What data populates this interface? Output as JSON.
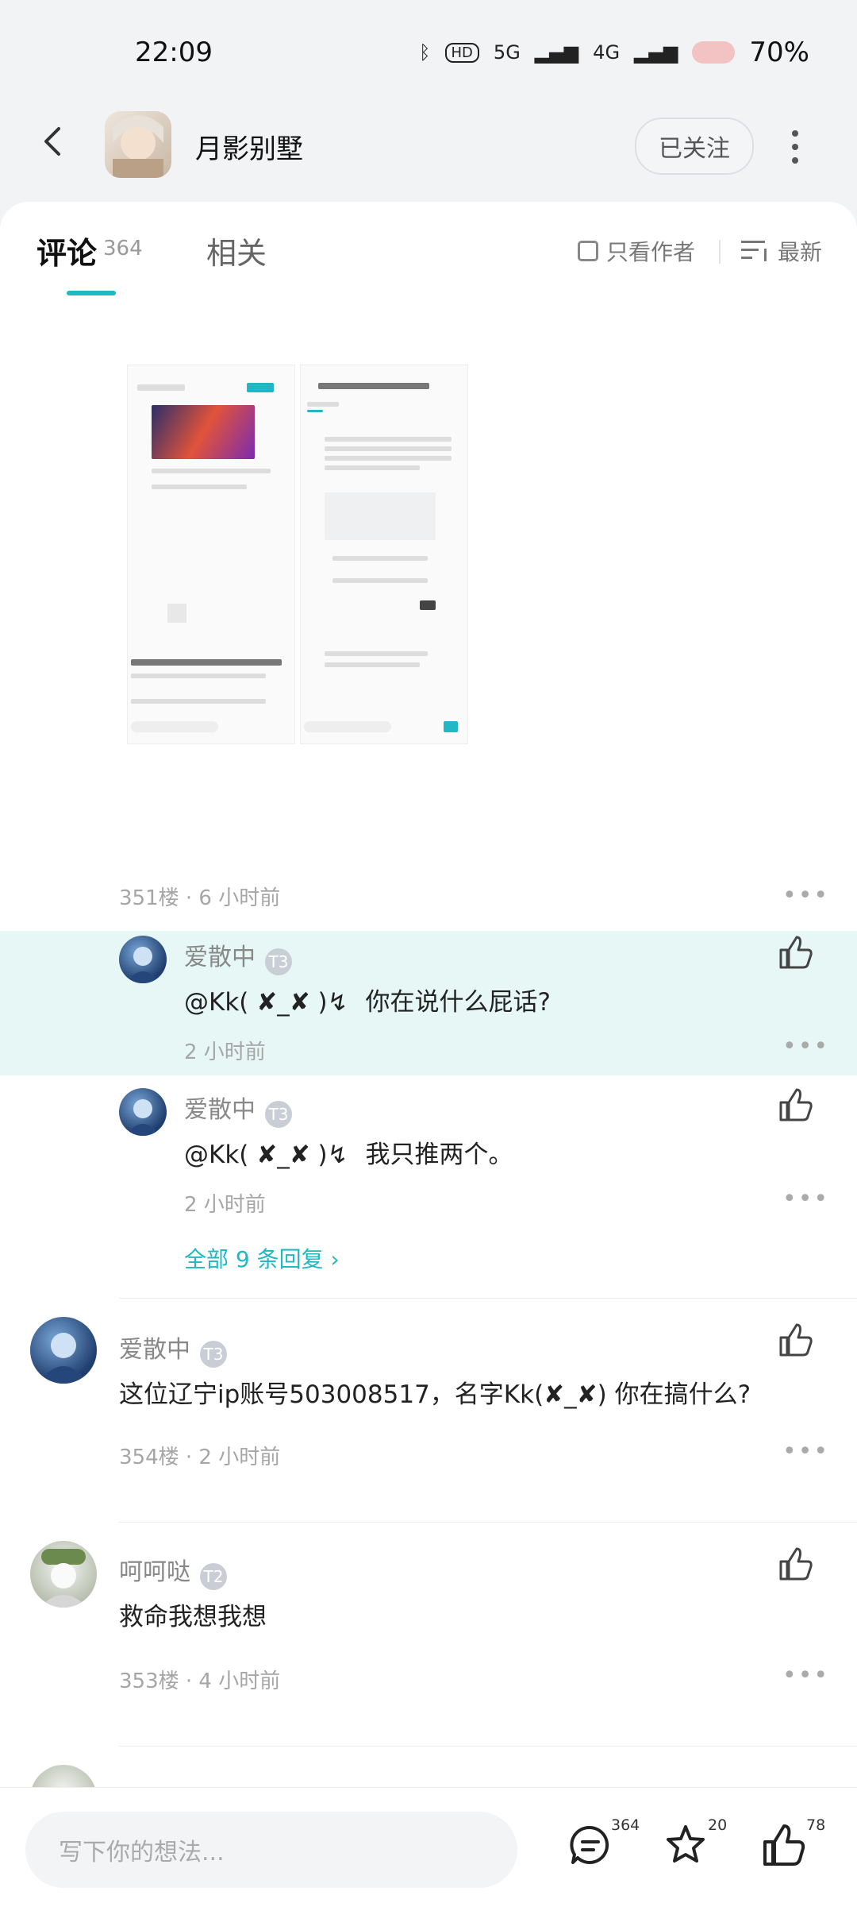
{
  "status_bar": {
    "time": "22:09",
    "network1": "5G",
    "network2": "4G",
    "battery": "70%"
  },
  "header": {
    "title": "月影别墅",
    "follow_label": "已关注"
  },
  "tabs": {
    "comments_label": "评论",
    "comments_count": "364",
    "related_label": "相关"
  },
  "filters": {
    "author_only": "只看作者",
    "sort_label": "最新"
  },
  "image_comment": {
    "meta": "351楼 · 6 小时前"
  },
  "replies": [
    {
      "name": "爱散中",
      "badge": "T3",
      "mention": "@Kk( ✘_✘ )↯",
      "text": "你在说什么屁话?",
      "meta": "2 小时前"
    },
    {
      "name": "爱散中",
      "badge": "T3",
      "mention": "@Kk( ✘_✘ )↯",
      "text": "我只推两个。",
      "meta": "2 小时前"
    }
  ],
  "replies_more": "全部 9 条回复 ›",
  "comments": [
    {
      "name": "爱散中",
      "badge": "T3",
      "text": "这位辽宁ip账号503008517，名字Kk(✘_✘) 你在搞什么?",
      "meta": "354楼 · 2 小时前"
    },
    {
      "name": "呵呵哒",
      "badge": "T2",
      "text": "救命我想我想",
      "meta": "353楼 · 4 小时前"
    }
  ],
  "bottom_bar": {
    "placeholder": "写下你的想法...",
    "comment_count": "364",
    "star_count": "20",
    "like_count": "78"
  },
  "colors": {
    "accent": "#1fb8c4",
    "highlight": "#e6f7f6"
  }
}
